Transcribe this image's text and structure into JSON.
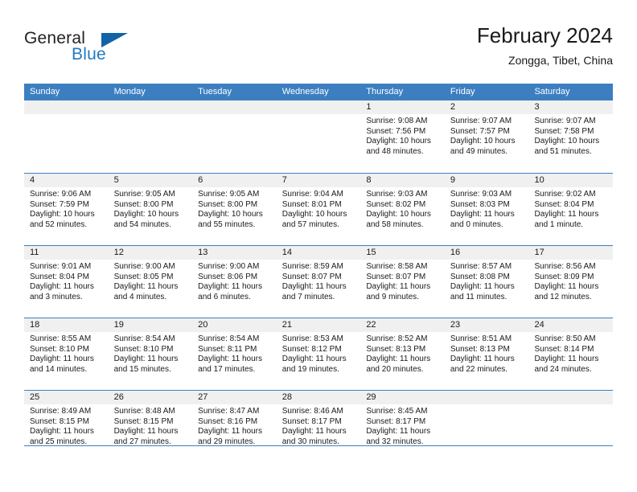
{
  "brand": {
    "name_part1": "General",
    "name_part2": "Blue",
    "accent_color": "#1263a8",
    "text_color": "#1f7ac4"
  },
  "header": {
    "title": "February 2024",
    "subtitle": "Zongga, Tibet, China"
  },
  "calendar": {
    "header_bg": "#3c7fc1",
    "daynum_bg": "#f0f0f0",
    "weekdays": [
      "Sunday",
      "Monday",
      "Tuesday",
      "Wednesday",
      "Thursday",
      "Friday",
      "Saturday"
    ],
    "weeks": [
      [
        {
          "day": "",
          "sunrise": "",
          "sunset": "",
          "daylight_line1": "",
          "daylight_line2": "",
          "empty": true
        },
        {
          "day": "",
          "sunrise": "",
          "sunset": "",
          "daylight_line1": "",
          "daylight_line2": "",
          "empty": true
        },
        {
          "day": "",
          "sunrise": "",
          "sunset": "",
          "daylight_line1": "",
          "daylight_line2": "",
          "empty": true
        },
        {
          "day": "",
          "sunrise": "",
          "sunset": "",
          "daylight_line1": "",
          "daylight_line2": "",
          "empty": true
        },
        {
          "day": "1",
          "sunrise": "Sunrise: 9:08 AM",
          "sunset": "Sunset: 7:56 PM",
          "daylight_line1": "Daylight: 10 hours",
          "daylight_line2": "and 48 minutes.",
          "empty": false
        },
        {
          "day": "2",
          "sunrise": "Sunrise: 9:07 AM",
          "sunset": "Sunset: 7:57 PM",
          "daylight_line1": "Daylight: 10 hours",
          "daylight_line2": "and 49 minutes.",
          "empty": false
        },
        {
          "day": "3",
          "sunrise": "Sunrise: 9:07 AM",
          "sunset": "Sunset: 7:58 PM",
          "daylight_line1": "Daylight: 10 hours",
          "daylight_line2": "and 51 minutes.",
          "empty": false
        }
      ],
      [
        {
          "day": "4",
          "sunrise": "Sunrise: 9:06 AM",
          "sunset": "Sunset: 7:59 PM",
          "daylight_line1": "Daylight: 10 hours",
          "daylight_line2": "and 52 minutes.",
          "empty": false
        },
        {
          "day": "5",
          "sunrise": "Sunrise: 9:05 AM",
          "sunset": "Sunset: 8:00 PM",
          "daylight_line1": "Daylight: 10 hours",
          "daylight_line2": "and 54 minutes.",
          "empty": false
        },
        {
          "day": "6",
          "sunrise": "Sunrise: 9:05 AM",
          "sunset": "Sunset: 8:00 PM",
          "daylight_line1": "Daylight: 10 hours",
          "daylight_line2": "and 55 minutes.",
          "empty": false
        },
        {
          "day": "7",
          "sunrise": "Sunrise: 9:04 AM",
          "sunset": "Sunset: 8:01 PM",
          "daylight_line1": "Daylight: 10 hours",
          "daylight_line2": "and 57 minutes.",
          "empty": false
        },
        {
          "day": "8",
          "sunrise": "Sunrise: 9:03 AM",
          "sunset": "Sunset: 8:02 PM",
          "daylight_line1": "Daylight: 10 hours",
          "daylight_line2": "and 58 minutes.",
          "empty": false
        },
        {
          "day": "9",
          "sunrise": "Sunrise: 9:03 AM",
          "sunset": "Sunset: 8:03 PM",
          "daylight_line1": "Daylight: 11 hours",
          "daylight_line2": "and 0 minutes.",
          "empty": false
        },
        {
          "day": "10",
          "sunrise": "Sunrise: 9:02 AM",
          "sunset": "Sunset: 8:04 PM",
          "daylight_line1": "Daylight: 11 hours",
          "daylight_line2": "and 1 minute.",
          "empty": false
        }
      ],
      [
        {
          "day": "11",
          "sunrise": "Sunrise: 9:01 AM",
          "sunset": "Sunset: 8:04 PM",
          "daylight_line1": "Daylight: 11 hours",
          "daylight_line2": "and 3 minutes.",
          "empty": false
        },
        {
          "day": "12",
          "sunrise": "Sunrise: 9:00 AM",
          "sunset": "Sunset: 8:05 PM",
          "daylight_line1": "Daylight: 11 hours",
          "daylight_line2": "and 4 minutes.",
          "empty": false
        },
        {
          "day": "13",
          "sunrise": "Sunrise: 9:00 AM",
          "sunset": "Sunset: 8:06 PM",
          "daylight_line1": "Daylight: 11 hours",
          "daylight_line2": "and 6 minutes.",
          "empty": false
        },
        {
          "day": "14",
          "sunrise": "Sunrise: 8:59 AM",
          "sunset": "Sunset: 8:07 PM",
          "daylight_line1": "Daylight: 11 hours",
          "daylight_line2": "and 7 minutes.",
          "empty": false
        },
        {
          "day": "15",
          "sunrise": "Sunrise: 8:58 AM",
          "sunset": "Sunset: 8:07 PM",
          "daylight_line1": "Daylight: 11 hours",
          "daylight_line2": "and 9 minutes.",
          "empty": false
        },
        {
          "day": "16",
          "sunrise": "Sunrise: 8:57 AM",
          "sunset": "Sunset: 8:08 PM",
          "daylight_line1": "Daylight: 11 hours",
          "daylight_line2": "and 11 minutes.",
          "empty": false
        },
        {
          "day": "17",
          "sunrise": "Sunrise: 8:56 AM",
          "sunset": "Sunset: 8:09 PM",
          "daylight_line1": "Daylight: 11 hours",
          "daylight_line2": "and 12 minutes.",
          "empty": false
        }
      ],
      [
        {
          "day": "18",
          "sunrise": "Sunrise: 8:55 AM",
          "sunset": "Sunset: 8:10 PM",
          "daylight_line1": "Daylight: 11 hours",
          "daylight_line2": "and 14 minutes.",
          "empty": false
        },
        {
          "day": "19",
          "sunrise": "Sunrise: 8:54 AM",
          "sunset": "Sunset: 8:10 PM",
          "daylight_line1": "Daylight: 11 hours",
          "daylight_line2": "and 15 minutes.",
          "empty": false
        },
        {
          "day": "20",
          "sunrise": "Sunrise: 8:54 AM",
          "sunset": "Sunset: 8:11 PM",
          "daylight_line1": "Daylight: 11 hours",
          "daylight_line2": "and 17 minutes.",
          "empty": false
        },
        {
          "day": "21",
          "sunrise": "Sunrise: 8:53 AM",
          "sunset": "Sunset: 8:12 PM",
          "daylight_line1": "Daylight: 11 hours",
          "daylight_line2": "and 19 minutes.",
          "empty": false
        },
        {
          "day": "22",
          "sunrise": "Sunrise: 8:52 AM",
          "sunset": "Sunset: 8:13 PM",
          "daylight_line1": "Daylight: 11 hours",
          "daylight_line2": "and 20 minutes.",
          "empty": false
        },
        {
          "day": "23",
          "sunrise": "Sunrise: 8:51 AM",
          "sunset": "Sunset: 8:13 PM",
          "daylight_line1": "Daylight: 11 hours",
          "daylight_line2": "and 22 minutes.",
          "empty": false
        },
        {
          "day": "24",
          "sunrise": "Sunrise: 8:50 AM",
          "sunset": "Sunset: 8:14 PM",
          "daylight_line1": "Daylight: 11 hours",
          "daylight_line2": "and 24 minutes.",
          "empty": false
        }
      ],
      [
        {
          "day": "25",
          "sunrise": "Sunrise: 8:49 AM",
          "sunset": "Sunset: 8:15 PM",
          "daylight_line1": "Daylight: 11 hours",
          "daylight_line2": "and 25 minutes.",
          "empty": false
        },
        {
          "day": "26",
          "sunrise": "Sunrise: 8:48 AM",
          "sunset": "Sunset: 8:15 PM",
          "daylight_line1": "Daylight: 11 hours",
          "daylight_line2": "and 27 minutes.",
          "empty": false
        },
        {
          "day": "27",
          "sunrise": "Sunrise: 8:47 AM",
          "sunset": "Sunset: 8:16 PM",
          "daylight_line1": "Daylight: 11 hours",
          "daylight_line2": "and 29 minutes.",
          "empty": false
        },
        {
          "day": "28",
          "sunrise": "Sunrise: 8:46 AM",
          "sunset": "Sunset: 8:17 PM",
          "daylight_line1": "Daylight: 11 hours",
          "daylight_line2": "and 30 minutes.",
          "empty": false
        },
        {
          "day": "29",
          "sunrise": "Sunrise: 8:45 AM",
          "sunset": "Sunset: 8:17 PM",
          "daylight_line1": "Daylight: 11 hours",
          "daylight_line2": "and 32 minutes.",
          "empty": false
        },
        {
          "day": "",
          "sunrise": "",
          "sunset": "",
          "daylight_line1": "",
          "daylight_line2": "",
          "empty": true
        },
        {
          "day": "",
          "sunrise": "",
          "sunset": "",
          "daylight_line1": "",
          "daylight_line2": "",
          "empty": true
        }
      ]
    ]
  }
}
